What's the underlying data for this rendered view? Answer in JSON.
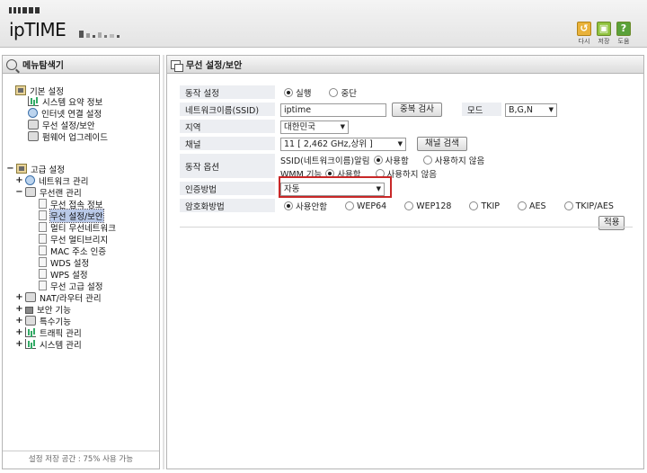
{
  "header": {
    "logo_text": "ipTIME",
    "buttons": [
      {
        "label": "다시",
        "color": "#e9b23a"
      },
      {
        "label": "저장",
        "color": "#8fc23d"
      },
      {
        "label": "도움",
        "color": "#5aa13a"
      }
    ]
  },
  "left_panel": {
    "title": "메뉴탐색기",
    "basic": {
      "group": "기본 설정",
      "items": [
        "시스템 요약 정보",
        "인터넷 연결 설정",
        "무선 설정/보안",
        "펌웨어 업그레이드"
      ]
    },
    "advanced": {
      "group": "고급 설정",
      "network": "네트워크 관리",
      "wireless_lan": "무선랜 관리",
      "wireless_items": [
        "무선 접속 정보",
        "무선 설정/보안",
        "멀티 무선네트워크",
        "무선 멀티브리지",
        "MAC 주소 인증",
        "WDS 설정",
        "WPS 설정",
        "무선 고급 설정"
      ],
      "others": [
        "NAT/라우터 관리",
        "보안 기능",
        "특수기능",
        "트래픽 관리",
        "시스템 관리"
      ]
    },
    "footer": "설정 저장 공간 : 75% 사용 가능"
  },
  "main": {
    "title": "무선 설정/보안",
    "rows": {
      "operation": {
        "label": "동작 설정",
        "opt_run": "실행",
        "opt_stop": "중단"
      },
      "ssid": {
        "label": "네트워크이름(SSID)",
        "value": "iptime",
        "dup_button": "중복 검사",
        "mode_label": "모드",
        "mode_value": "B,G,N"
      },
      "region": {
        "label": "지역",
        "value": "대한민국"
      },
      "channel": {
        "label": "채널",
        "value": "11 [ 2,462 GHz,상위 ]",
        "search_button": "채널 검색"
      },
      "options": {
        "label": "동작 옵션",
        "ssid_broadcast_label": "SSID(네트워크이름)알림",
        "wmm_label": "WMM 기능",
        "use": "사용함",
        "no_use": "사용하지 않음"
      },
      "auth": {
        "label": "인증방법",
        "value": "자동"
      },
      "encryption": {
        "label": "암호화방법",
        "options": [
          "사용안함",
          "WEP64",
          "WEP128",
          "TKIP",
          "AES",
          "TKIP/AES"
        ],
        "selected": "사용안함"
      }
    },
    "apply_button": "적용"
  }
}
